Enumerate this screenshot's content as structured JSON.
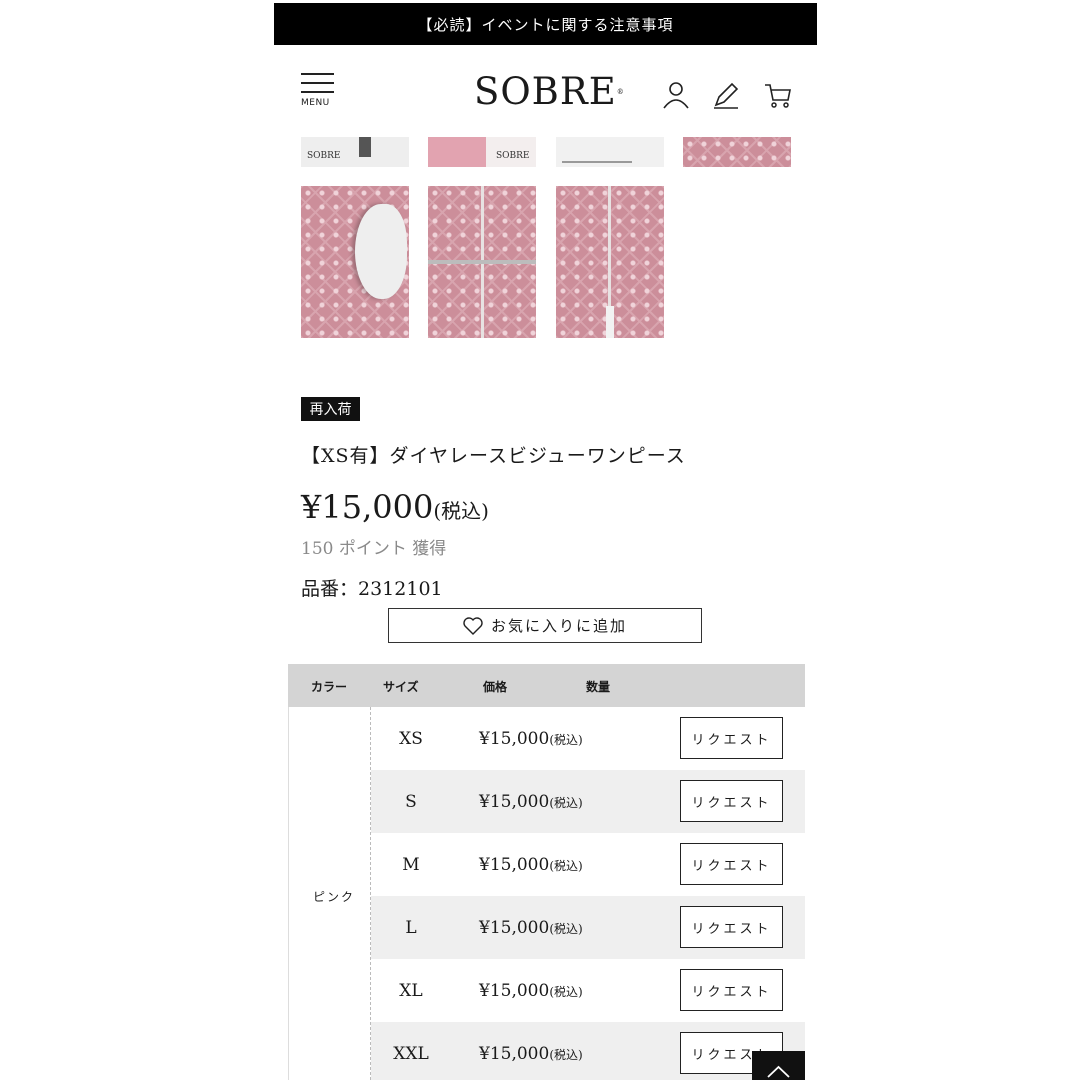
{
  "notice": {
    "text": "【必読】イベントに関する注意事項"
  },
  "header": {
    "menu_label": "MENU",
    "logo": "SOBRE",
    "icons": [
      "user-icon",
      "pen-icon",
      "cart-icon"
    ]
  },
  "gallery": {
    "thumb_logo": "SOBRE"
  },
  "product": {
    "badge": "再入荷",
    "title": "【XS有】ダイヤレースビジューワンピース",
    "price": "¥15,000",
    "tax": "(税込)",
    "points": "150 ポイント 獲得",
    "sku": "品番：2312101",
    "favorite_label": "お気に入りに追加"
  },
  "table": {
    "headers": {
      "color": "カラー",
      "size": "サイズ",
      "price": "価格",
      "qty": "数量"
    },
    "color": "ピンク",
    "rows": [
      {
        "size": "XS",
        "price": "¥15,000",
        "tax": "(税込)",
        "button": "リクエスト"
      },
      {
        "size": "S",
        "price": "¥15,000",
        "tax": "(税込)",
        "button": "リクエスト"
      },
      {
        "size": "M",
        "price": "¥15,000",
        "tax": "(税込)",
        "button": "リクエスト"
      },
      {
        "size": "L",
        "price": "¥15,000",
        "tax": "(税込)",
        "button": "リクエスト"
      },
      {
        "size": "XL",
        "price": "¥15,000",
        "tax": "(税込)",
        "button": "リクエスト"
      },
      {
        "size": "XXL",
        "price": "¥15,000",
        "tax": "(税込)",
        "button": "リクエスト"
      }
    ]
  },
  "colors": {
    "accent": "#000000",
    "swatch": "#cc8e9a",
    "header_bg": "#d4d4d4"
  }
}
